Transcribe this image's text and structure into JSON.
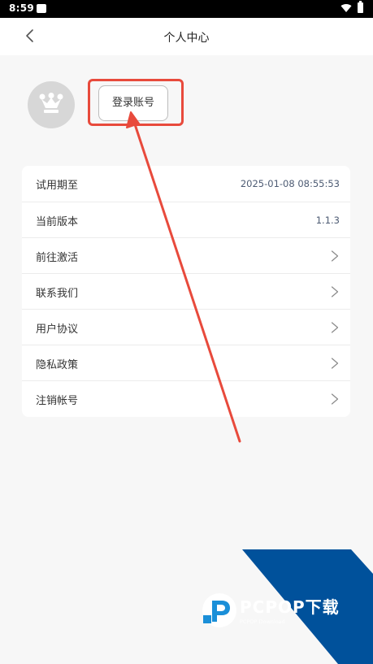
{
  "status_bar": {
    "time": "8:59"
  },
  "header": {
    "title": "个人中心"
  },
  "profile": {
    "login_button_label": "登录账号"
  },
  "menu": [
    {
      "label": "试用期至",
      "value": "2025-01-08 08:55:53"
    },
    {
      "label": "当前版本",
      "value": "1.1.3"
    },
    {
      "label": "前往激活",
      "value": null
    },
    {
      "label": "联系我们",
      "value": null
    },
    {
      "label": "用户协议",
      "value": null
    },
    {
      "label": "隐私政策",
      "value": null
    },
    {
      "label": "注销帐号",
      "value": null
    }
  ],
  "icons": {
    "status": [
      "notification-icon",
      "wifi-icon",
      "battery-icon"
    ],
    "back": "back-arrow-icon",
    "avatar": "crown-icon",
    "row_action": "chevron-right-icon"
  },
  "colors": {
    "annotation_red": "#e84a3c",
    "row_value": "#4d5b73",
    "watermark_blue": "#00519b"
  }
}
